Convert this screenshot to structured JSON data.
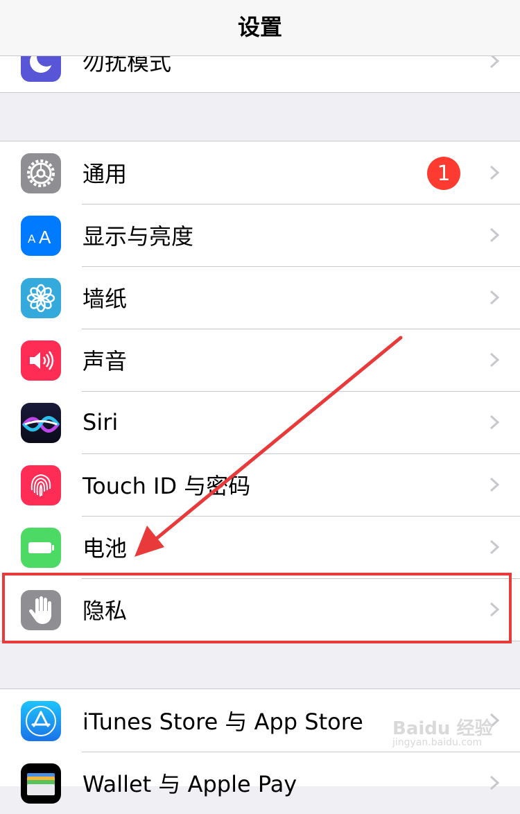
{
  "nav": {
    "title": "设置"
  },
  "group1": {
    "items": [
      {
        "label": "勿扰模式",
        "icon": "moon-icon",
        "color": "#5856d6"
      }
    ]
  },
  "group2": {
    "items": [
      {
        "label": "通用",
        "icon": "gear-icon",
        "color": "#8e8e93",
        "badge": "1"
      },
      {
        "label": "显示与亮度",
        "icon": "text-size-icon",
        "color": "#007aff"
      },
      {
        "label": "墙纸",
        "icon": "flower-icon",
        "color": "#34aadc"
      },
      {
        "label": "声音",
        "icon": "speaker-icon",
        "color": "#ff2d55"
      },
      {
        "label": "Siri",
        "icon": "siri-icon",
        "color": "#1b1b4a"
      },
      {
        "label": "Touch ID 与密码",
        "icon": "fingerprint-icon",
        "color": "#ff2d55"
      },
      {
        "label": "电池",
        "icon": "battery-icon",
        "color": "#4cd964"
      },
      {
        "label": "隐私",
        "icon": "hand-icon",
        "color": "#8e8e93"
      }
    ]
  },
  "group3": {
    "items": [
      {
        "label": "iTunes Store 与 App Store",
        "icon": "app-store-icon",
        "color": "#1a8cf0"
      },
      {
        "label": "Wallet 与 Apple Pay",
        "icon": "wallet-icon",
        "color": "#000000"
      }
    ]
  },
  "annotation": {
    "highlight_color": "#e83a3a"
  },
  "watermark": {
    "text": "Baidu 经验",
    "sub": "jingyan.baidu.com"
  }
}
